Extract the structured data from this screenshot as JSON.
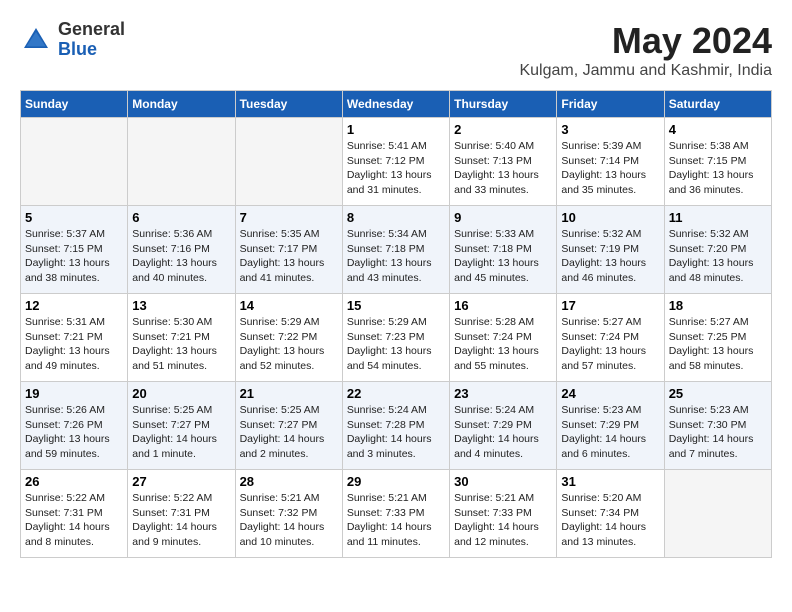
{
  "logo": {
    "general": "General",
    "blue": "Blue"
  },
  "title": "May 2024",
  "location": "Kulgam, Jammu and Kashmir, India",
  "headers": [
    "Sunday",
    "Monday",
    "Tuesday",
    "Wednesday",
    "Thursday",
    "Friday",
    "Saturday"
  ],
  "weeks": [
    [
      {
        "day": "",
        "info": ""
      },
      {
        "day": "",
        "info": ""
      },
      {
        "day": "",
        "info": ""
      },
      {
        "day": "1",
        "info": "Sunrise: 5:41 AM\nSunset: 7:12 PM\nDaylight: 13 hours\nand 31 minutes."
      },
      {
        "day": "2",
        "info": "Sunrise: 5:40 AM\nSunset: 7:13 PM\nDaylight: 13 hours\nand 33 minutes."
      },
      {
        "day": "3",
        "info": "Sunrise: 5:39 AM\nSunset: 7:14 PM\nDaylight: 13 hours\nand 35 minutes."
      },
      {
        "day": "4",
        "info": "Sunrise: 5:38 AM\nSunset: 7:15 PM\nDaylight: 13 hours\nand 36 minutes."
      }
    ],
    [
      {
        "day": "5",
        "info": "Sunrise: 5:37 AM\nSunset: 7:15 PM\nDaylight: 13 hours\nand 38 minutes."
      },
      {
        "day": "6",
        "info": "Sunrise: 5:36 AM\nSunset: 7:16 PM\nDaylight: 13 hours\nand 40 minutes."
      },
      {
        "day": "7",
        "info": "Sunrise: 5:35 AM\nSunset: 7:17 PM\nDaylight: 13 hours\nand 41 minutes."
      },
      {
        "day": "8",
        "info": "Sunrise: 5:34 AM\nSunset: 7:18 PM\nDaylight: 13 hours\nand 43 minutes."
      },
      {
        "day": "9",
        "info": "Sunrise: 5:33 AM\nSunset: 7:18 PM\nDaylight: 13 hours\nand 45 minutes."
      },
      {
        "day": "10",
        "info": "Sunrise: 5:32 AM\nSunset: 7:19 PM\nDaylight: 13 hours\nand 46 minutes."
      },
      {
        "day": "11",
        "info": "Sunrise: 5:32 AM\nSunset: 7:20 PM\nDaylight: 13 hours\nand 48 minutes."
      }
    ],
    [
      {
        "day": "12",
        "info": "Sunrise: 5:31 AM\nSunset: 7:21 PM\nDaylight: 13 hours\nand 49 minutes."
      },
      {
        "day": "13",
        "info": "Sunrise: 5:30 AM\nSunset: 7:21 PM\nDaylight: 13 hours\nand 51 minutes."
      },
      {
        "day": "14",
        "info": "Sunrise: 5:29 AM\nSunset: 7:22 PM\nDaylight: 13 hours\nand 52 minutes."
      },
      {
        "day": "15",
        "info": "Sunrise: 5:29 AM\nSunset: 7:23 PM\nDaylight: 13 hours\nand 54 minutes."
      },
      {
        "day": "16",
        "info": "Sunrise: 5:28 AM\nSunset: 7:24 PM\nDaylight: 13 hours\nand 55 minutes."
      },
      {
        "day": "17",
        "info": "Sunrise: 5:27 AM\nSunset: 7:24 PM\nDaylight: 13 hours\nand 57 minutes."
      },
      {
        "day": "18",
        "info": "Sunrise: 5:27 AM\nSunset: 7:25 PM\nDaylight: 13 hours\nand 58 minutes."
      }
    ],
    [
      {
        "day": "19",
        "info": "Sunrise: 5:26 AM\nSunset: 7:26 PM\nDaylight: 13 hours\nand 59 minutes."
      },
      {
        "day": "20",
        "info": "Sunrise: 5:25 AM\nSunset: 7:27 PM\nDaylight: 14 hours\nand 1 minute."
      },
      {
        "day": "21",
        "info": "Sunrise: 5:25 AM\nSunset: 7:27 PM\nDaylight: 14 hours\nand 2 minutes."
      },
      {
        "day": "22",
        "info": "Sunrise: 5:24 AM\nSunset: 7:28 PM\nDaylight: 14 hours\nand 3 minutes."
      },
      {
        "day": "23",
        "info": "Sunrise: 5:24 AM\nSunset: 7:29 PM\nDaylight: 14 hours\nand 4 minutes."
      },
      {
        "day": "24",
        "info": "Sunrise: 5:23 AM\nSunset: 7:29 PM\nDaylight: 14 hours\nand 6 minutes."
      },
      {
        "day": "25",
        "info": "Sunrise: 5:23 AM\nSunset: 7:30 PM\nDaylight: 14 hours\nand 7 minutes."
      }
    ],
    [
      {
        "day": "26",
        "info": "Sunrise: 5:22 AM\nSunset: 7:31 PM\nDaylight: 14 hours\nand 8 minutes."
      },
      {
        "day": "27",
        "info": "Sunrise: 5:22 AM\nSunset: 7:31 PM\nDaylight: 14 hours\nand 9 minutes."
      },
      {
        "day": "28",
        "info": "Sunrise: 5:21 AM\nSunset: 7:32 PM\nDaylight: 14 hours\nand 10 minutes."
      },
      {
        "day": "29",
        "info": "Sunrise: 5:21 AM\nSunset: 7:33 PM\nDaylight: 14 hours\nand 11 minutes."
      },
      {
        "day": "30",
        "info": "Sunrise: 5:21 AM\nSunset: 7:33 PM\nDaylight: 14 hours\nand 12 minutes."
      },
      {
        "day": "31",
        "info": "Sunrise: 5:20 AM\nSunset: 7:34 PM\nDaylight: 14 hours\nand 13 minutes."
      },
      {
        "day": "",
        "info": ""
      }
    ]
  ]
}
